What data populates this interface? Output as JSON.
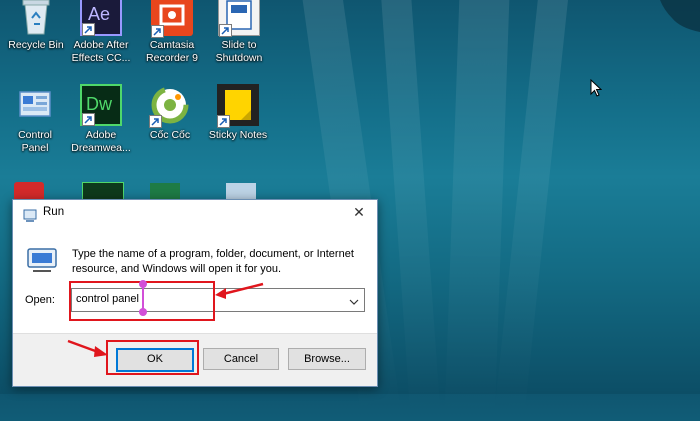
{
  "desktop": {
    "icons": [
      {
        "id": "recycle-bin",
        "label": "Recycle Bin",
        "icon": "recycle-bin-icon"
      },
      {
        "id": "after-effects",
        "label": "Adobe After\nEffects CC...",
        "icon": "after-effects-icon",
        "glyph": "Ae"
      },
      {
        "id": "camtasia",
        "label": "Camtasia\nRecorder 9",
        "icon": "camtasia-icon"
      },
      {
        "id": "slide-to-shutdown",
        "label": "Slide to\nShutdown",
        "icon": "slide-to-shutdown-icon"
      },
      {
        "id": "control-panel",
        "label": "Control\nPanel",
        "icon": "control-panel-icon"
      },
      {
        "id": "dreamweaver",
        "label": "Adobe\nDreamwea...",
        "icon": "dreamweaver-icon",
        "glyph": "Dw"
      },
      {
        "id": "coc-coc",
        "label": "Cốc Cốc",
        "icon": "coc-coc-icon"
      },
      {
        "id": "sticky-notes",
        "label": "Sticky Notes",
        "icon": "sticky-notes-icon"
      }
    ]
  },
  "run_dialog": {
    "title": "Run",
    "description": "Type the name of a program, folder, document, or Internet resource, and Windows will open it for you.",
    "open_label": "Open:",
    "open_value": "control panel",
    "ok_label": "OK",
    "cancel_label": "Cancel",
    "browse_label": "Browse..."
  },
  "colors": {
    "highlight": "#e0161d",
    "cursor_marker": "#d24fd8",
    "ok_focus": "#0078d7"
  }
}
